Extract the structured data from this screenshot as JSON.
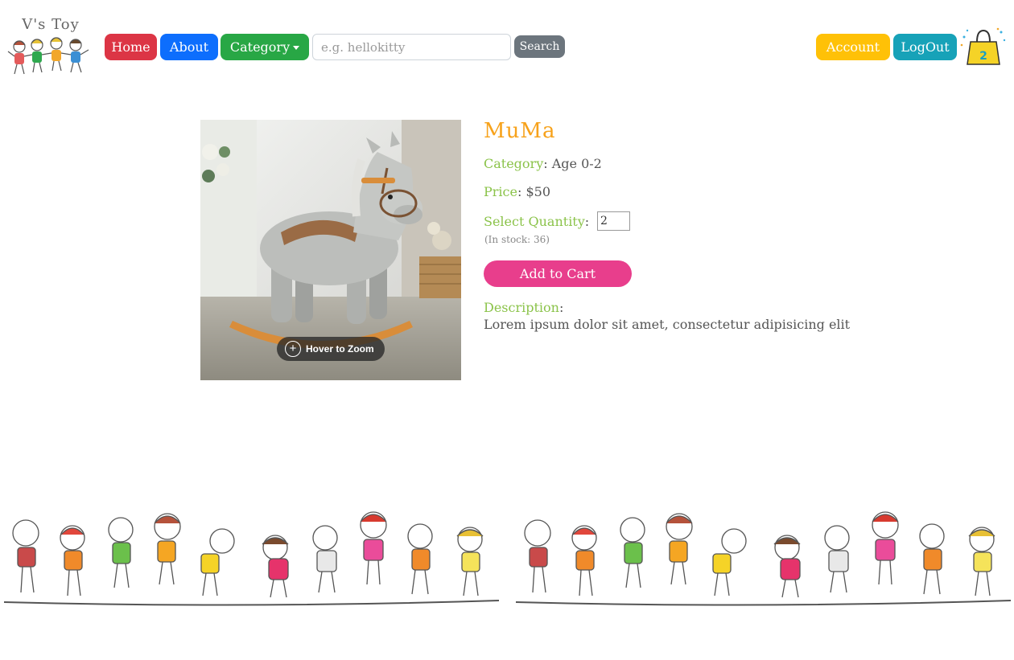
{
  "brand": {
    "logo_text": "V's Toy",
    "logo_icon": "kids-icon"
  },
  "nav": {
    "home": "Home",
    "about": "About",
    "category": "Category",
    "search_placeholder": "e.g. hellokitty",
    "search_button": "Search",
    "account": "Account",
    "logout": "LogOut",
    "cart_count": "2",
    "cart_icon": "shopping-bag-icon"
  },
  "product": {
    "name": "MuMa",
    "category_label": "Category",
    "category_value": "Age 0-2",
    "price_label": "Price",
    "price_value": "$50",
    "quantity_label": "Select Quantity",
    "quantity_value": "2",
    "stock_text": "(In stock: 36)",
    "add_to_cart": "Add to Cart",
    "description_label": "Description",
    "description_text": "Lorem ipsum dolor sit amet, consectetur adipisicing elit",
    "zoom_hint": "Hover to Zoom",
    "image_icon": "rocking-horse-image"
  },
  "colors": {
    "home": "#dc3545",
    "about": "#0d6efd",
    "category": "#28a745",
    "search": "#6c757d",
    "account": "#ffc107",
    "logout": "#17a2b8",
    "title": "#f7a21b",
    "label": "#8bc34a",
    "add_to_cart": "#e83e8c"
  },
  "footer": {
    "banner_icon": "dancing-kids-banner"
  }
}
